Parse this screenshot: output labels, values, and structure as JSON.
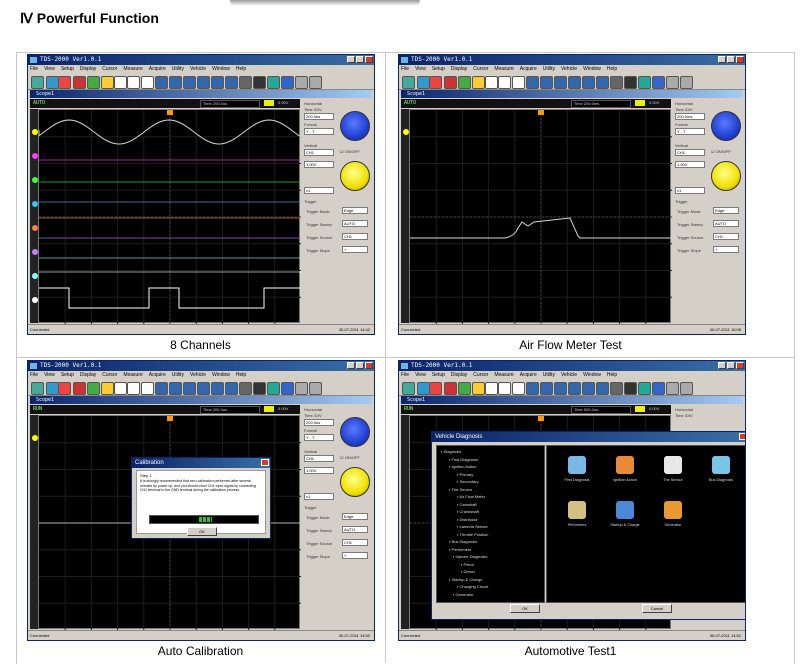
{
  "heading": "Ⅳ  Powerful Function",
  "captions": [
    "8 Channels",
    "Air Flow Meter Test",
    "Auto Calibration",
    "Automotive Test1"
  ],
  "app": {
    "title": "TDS-2000 Ver1.0.1",
    "menu": [
      "File",
      "View",
      "Setup",
      "Display",
      "Cursor",
      "Measure",
      "Acquire",
      "Utility",
      "Vehicle",
      "Window",
      "Help"
    ],
    "scope_window": "Scope1",
    "status_left": "Connected",
    "status_right": "30-07-2011  14:42"
  },
  "screens": [
    {
      "status": "AUTO",
      "timebase": "Time 200.0us",
      "horizontal_label": "Horizontal",
      "time_div_label": "Time /DIV",
      "time_div": "200.0us",
      "format_label": "Format",
      "format": "Y - T",
      "vertical_label": "Vertical",
      "channel": "CH1",
      "volt_div": "1.00V",
      "probe": "x1",
      "onoff": "ON/OFF",
      "trigger_label": "Trigger",
      "trigger_mode_label": "Trigger Mode",
      "trigger_mode": "Edge",
      "trigger_sweep_label": "Trigger Sweep",
      "trigger_sweep": "AUTO",
      "trigger_source_label": "Trigger Source",
      "trigger_source": "CH1",
      "trigger_slope_label": "Trigger Slope",
      "trigger_slope": "+",
      "status_right": "30-07-2011  14:42"
    },
    {
      "status": "AUTO",
      "timebase": "Time 200.0ms",
      "horizontal_label": "Horizontal",
      "time_div_label": "Time /DIV",
      "time_div": "200.0ms",
      "format_label": "Format",
      "format": "Y - T",
      "vertical_label": "Vertical",
      "channel": "CH1",
      "volt_div": "1.00V",
      "probe": "x1",
      "onoff": "ON/OFF",
      "trigger_label": "Trigger",
      "trigger_mode_label": "Trigger Mode",
      "trigger_mode": "Edge",
      "trigger_sweep_label": "Trigger Sweep",
      "trigger_sweep": "AUTO",
      "trigger_source_label": "Trigger Source",
      "trigger_source": "CH1",
      "trigger_slope_label": "Trigger Slope",
      "trigger_slope": "+",
      "status_right": "30-07-2011  15:08"
    },
    {
      "status": "RUN",
      "timebase": "Time 200.0us",
      "horizontal_label": "Horizontal",
      "time_div_label": "Time /DIV",
      "time_div": "200.0us",
      "format_label": "Format",
      "format": "Y - T",
      "vertical_label": "Vertical",
      "channel": "CH1",
      "volt_div": "1.00V",
      "probe": "x1",
      "onoff": "ON/OFF",
      "trigger_label": "Trigger",
      "trigger_mode_label": "Trigger Mode",
      "trigger_mode": "Edge",
      "trigger_sweep_label": "Trigger Sweep",
      "trigger_sweep": "AUTO",
      "trigger_source_label": "Trigger Source",
      "trigger_source": "CH1",
      "trigger_slope_label": "Trigger Slope",
      "trigger_slope": "+",
      "status_right": "30-07-2011  14:52"
    },
    {
      "status": "RUN",
      "timebase": "Time 500.0us",
      "horizontal_label": "Horizontal",
      "time_div_label": "Time /DIV",
      "status_right": "30-07-2011  14:52"
    }
  ],
  "calibration_dialog": {
    "title": "Calibration",
    "step": "Step 1",
    "message": "It is strongly recommended that zero calibration performed after several minutes by power up, and you should short CH1 input signal by connecting CH1 terminal to the GND terminal during the calibration process.",
    "button": "OK",
    "progress": 0.55
  },
  "vehicle_dialog": {
    "title": "Vehicle Diagnosis",
    "tree": [
      "Diagnosis",
      "First Diagnosis",
      "Ignition Action",
      "Primary",
      "Secondary",
      "The Sensor",
      "Air Flow Meter",
      "Camshaft",
      "Crankshaft",
      "Distributor",
      "Lambda Sensor",
      "Throttle Position",
      "Bus Diagnosis",
      "Performers",
      "Injector Diagnosis",
      "Petrol",
      "Diesel",
      "Startup & Charge",
      "Charging Circuit",
      "Generator"
    ],
    "icons": [
      {
        "label": "First Diagnosis",
        "color": "#7ab8e8"
      },
      {
        "label": "Ignition Action",
        "color": "#e88a3a"
      },
      {
        "label": "The Sensor",
        "color": "#e8e8e8"
      },
      {
        "label": "Bus Diagnosis",
        "color": "#7ac4e8"
      },
      {
        "label": "Performers",
        "color": "#d4c080"
      },
      {
        "label": "Startup & Charge",
        "color": "#4a8ad8"
      },
      {
        "label": "Generator",
        "color": "#e89a30"
      }
    ],
    "ok": "OK",
    "cancel": "Cancel"
  },
  "colors": {
    "titlebar": "#0a246a",
    "scope_bg": "#000000",
    "grid": "#2a2a2a",
    "trace_ch1": "#d8d8d8",
    "knob_blue": "#2040d0",
    "knob_yellow": "#f0e000"
  },
  "channel_colors": [
    "#ffff00",
    "#ff40ff",
    "#40ff40",
    "#40c0ff",
    "#ff8040",
    "#c080ff",
    "#80ffff",
    "#ffffff"
  ]
}
